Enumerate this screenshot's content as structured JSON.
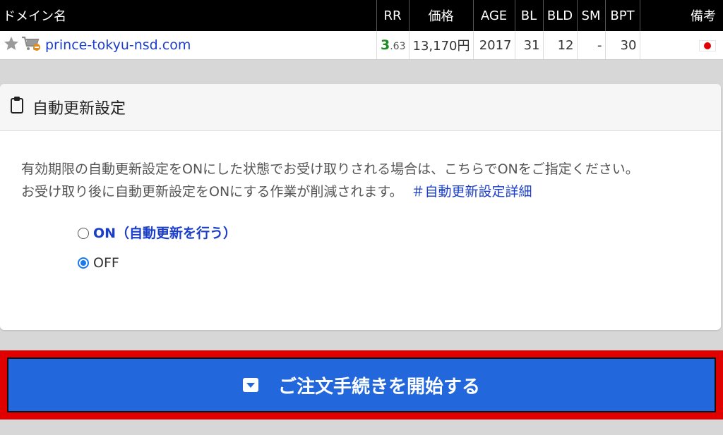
{
  "table": {
    "headers": {
      "domain": "ドメイン名",
      "rr": "RR",
      "price": "価格",
      "age": "AGE",
      "bl": "BL",
      "bld": "BLD",
      "sm": "SM",
      "bpt": "BPT",
      "note": "備考"
    },
    "row": {
      "domain": "prince-tokyu-nsd.com",
      "rr_main": "3",
      "rr_sub": ".63",
      "price": "13,170円",
      "age": "2017",
      "bl": "31",
      "bld": "12",
      "sm": "-",
      "bpt": "30",
      "note_icon": "japan-flag-icon"
    }
  },
  "auto_renew": {
    "title": "自動更新設定",
    "icon": "clipboard-icon",
    "description_line1": "有効期限の自動更新設定をONにした状態でお受け取りされる場合は、こちらでONをご指定ください。",
    "description_line2": "お受け取り後に自動更新設定をONにする作業が削減されます。",
    "detail_link": "＃自動更新設定詳細",
    "options": [
      {
        "label": "ON（自動更新を行う）",
        "checked": false
      },
      {
        "label": "OFF",
        "checked": true
      }
    ]
  },
  "order_button": {
    "label": "ご注文手続きを開始する",
    "icon": "caret-down-square-icon"
  },
  "colors": {
    "accent_blue": "#2268dc",
    "link_blue": "#1a3ec9",
    "highlight_red": "#e00000",
    "value_green": "#1f8a1f"
  }
}
